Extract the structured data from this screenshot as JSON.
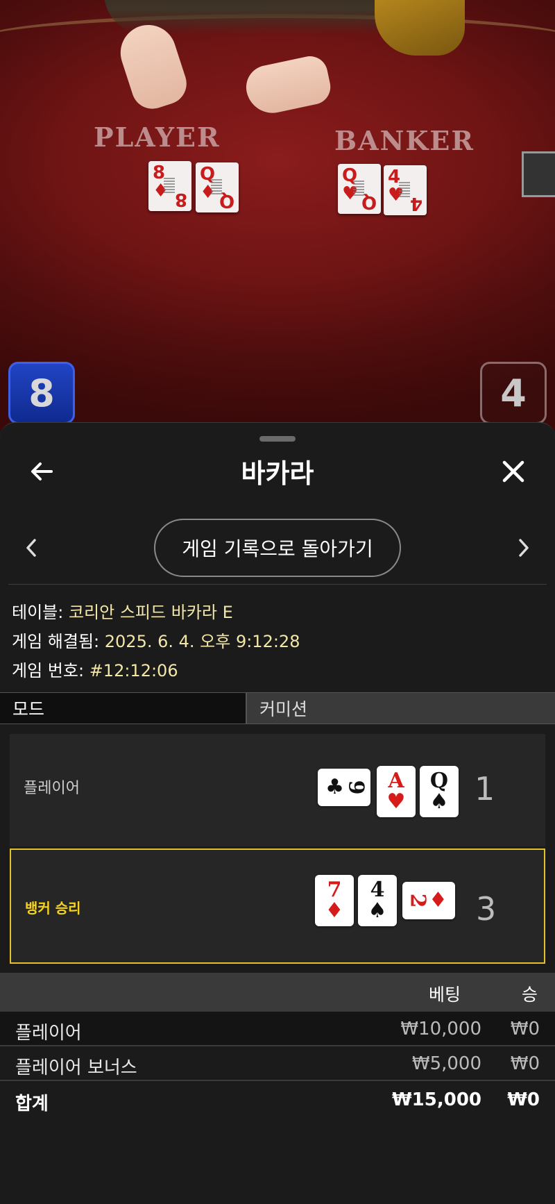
{
  "video": {
    "player_zone_label": "PLAYER",
    "banker_zone_label": "BANKER",
    "player_table_cards": [
      {
        "rank": "8",
        "suit": "♦"
      },
      {
        "rank": "Q",
        "suit": "♦"
      }
    ],
    "banker_table_cards": [
      {
        "rank": "Q",
        "suit": "♥"
      },
      {
        "rank": "4",
        "suit": "♥"
      }
    ],
    "player_score": "8",
    "banker_score": "4",
    "player_color": "#1f3fb8",
    "felt_color": "#7a1616"
  },
  "header": {
    "title": "바카라",
    "back_icon": "back-arrow-icon",
    "close_icon": "close-icon"
  },
  "navigation": {
    "back_to_history": "게임 기록으로 돌아가기",
    "prev_icon": "chevron-left-icon",
    "next_icon": "chevron-right-icon"
  },
  "info": {
    "table_label": "테이블:",
    "table_value": "코리안 스피드 바카라 E",
    "resolved_label": "게임 해결됨:",
    "resolved_value": "2025. 6. 4. 오후 9:12:28",
    "game_no_label": "게임 번호:",
    "game_no_value": "#12:12:06",
    "value_color": "#f3e7a8"
  },
  "mode": {
    "label": "모드",
    "value": "커미션"
  },
  "results": {
    "player": {
      "label": "플레이어",
      "score": "1",
      "cards": [
        {
          "rank": "9",
          "suit": "♣",
          "color": "black",
          "sideways": true
        },
        {
          "rank": "A",
          "suit": "♥",
          "color": "red",
          "sideways": false
        },
        {
          "rank": "Q",
          "suit": "♠",
          "color": "black",
          "sideways": false
        }
      ]
    },
    "banker": {
      "label": "뱅커 승리",
      "score": "3",
      "highlight_color": "#e2c22a",
      "cards": [
        {
          "rank": "7",
          "suit": "♦",
          "color": "red",
          "sideways": false
        },
        {
          "rank": "4",
          "suit": "♠",
          "color": "black",
          "sideways": false
        },
        {
          "rank": "2",
          "suit": "♦",
          "color": "red",
          "sideways": true
        }
      ]
    }
  },
  "bets": {
    "header_bet": "베팅",
    "header_win": "승",
    "rows": [
      {
        "name": "플레이어",
        "bet": "₩10,000",
        "win": "₩0"
      },
      {
        "name": "플레이어 보너스",
        "bet": "₩5,000",
        "win": "₩0"
      }
    ],
    "total": {
      "name": "합계",
      "bet": "₩15,000",
      "win": "₩0"
    }
  }
}
